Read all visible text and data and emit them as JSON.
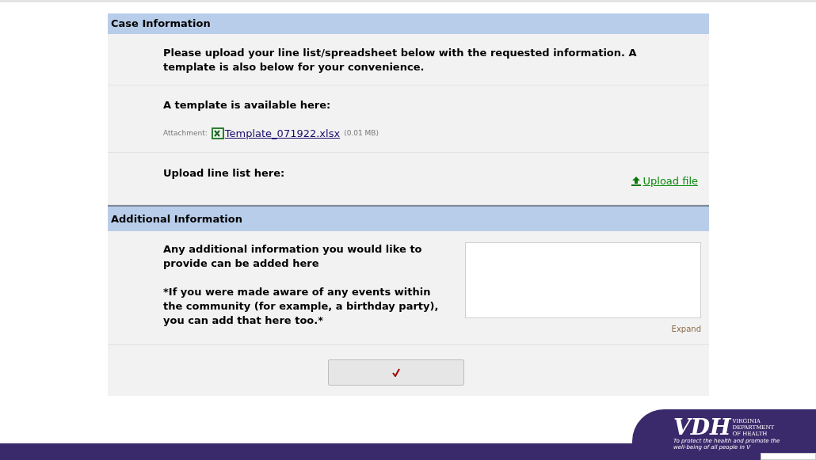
{
  "sections": [
    {
      "title": "Case Information",
      "rows": [
        {
          "kind": "text",
          "text": "Please upload your line list/spreadsheet below with the requested information. A template is also below for your convenience."
        },
        {
          "kind": "attachment",
          "label": "A template is available here:",
          "attachment_label": "Attachment:",
          "file_name": "Template_071922.xlsx",
          "file_size": "(0.01 MB)"
        },
        {
          "kind": "upload",
          "label": "Upload line list here:",
          "link": "Upload file"
        }
      ]
    },
    {
      "title": "Additional Information",
      "rows": [
        {
          "kind": "textarea",
          "paragraphs": [
            "Any additional information you would like to provide can be added here",
            "*If you were made aware of any events within the community (for example, a birthday party), you can add that here too.*"
          ],
          "expand": "Expand"
        }
      ]
    }
  ],
  "footer": {
    "logo": "VDH",
    "org_lines": [
      "VIRGINIA",
      "DEPARTMENT",
      "OF HEALTH"
    ],
    "tagline": [
      "To protect the health and promote the",
      "well-being of all people in V"
    ]
  }
}
